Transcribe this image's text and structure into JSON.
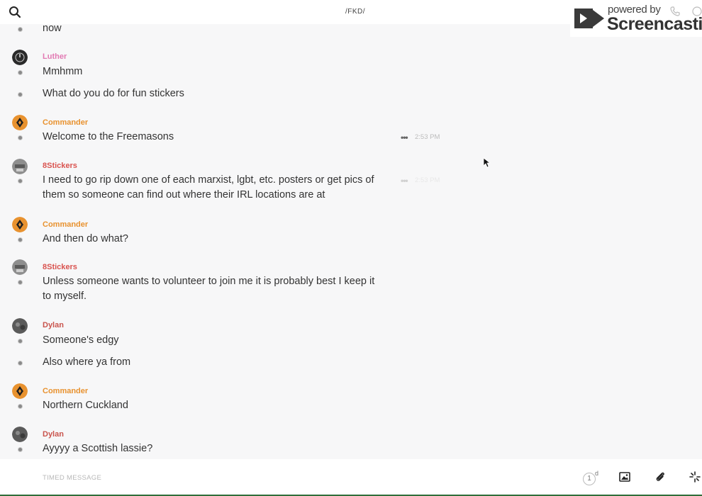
{
  "header": {
    "title": "/FKD/",
    "search_icon": "search-icon"
  },
  "watermark": {
    "powered_text": "powered by",
    "brand_text": "Screencastify"
  },
  "messages": [
    {
      "text": "now"
    },
    {
      "author": "Luther",
      "text": "Mmhmm"
    },
    {
      "text": "What do you do for fun stickers"
    },
    {
      "author": "Commander",
      "text": "Welcome to the Freemasons",
      "time": "2:53 PM"
    },
    {
      "author": "8Stickers",
      "text": "I need to go rip down one of each marxist, lgbt, etc. posters or get pics of them so someone can find out where their IRL locations are at",
      "time": "2:53 PM"
    },
    {
      "author": "Commander",
      "text": "And then do what?"
    },
    {
      "author": "8Stickers",
      "text": "Unless someone wants to volunteer to join me it is probably best I keep it to myself."
    },
    {
      "author": "Dylan",
      "text": "Someone's edgy"
    },
    {
      "text": "Also where ya from"
    },
    {
      "author": "Commander",
      "text": "Northern Cuckland"
    },
    {
      "author": "Dylan",
      "text": "Ayyyy a Scottish lassie?"
    }
  ],
  "composer": {
    "placeholder": "TIMED MESSAGE",
    "timer_value": "1",
    "timer_unit": "d"
  },
  "colors": {
    "luther": "#e27ab3",
    "commander": "#e8922f",
    "stickers": "#d9534f",
    "dylan": "#c9544d",
    "bottom_border": "#2f6e3a"
  }
}
